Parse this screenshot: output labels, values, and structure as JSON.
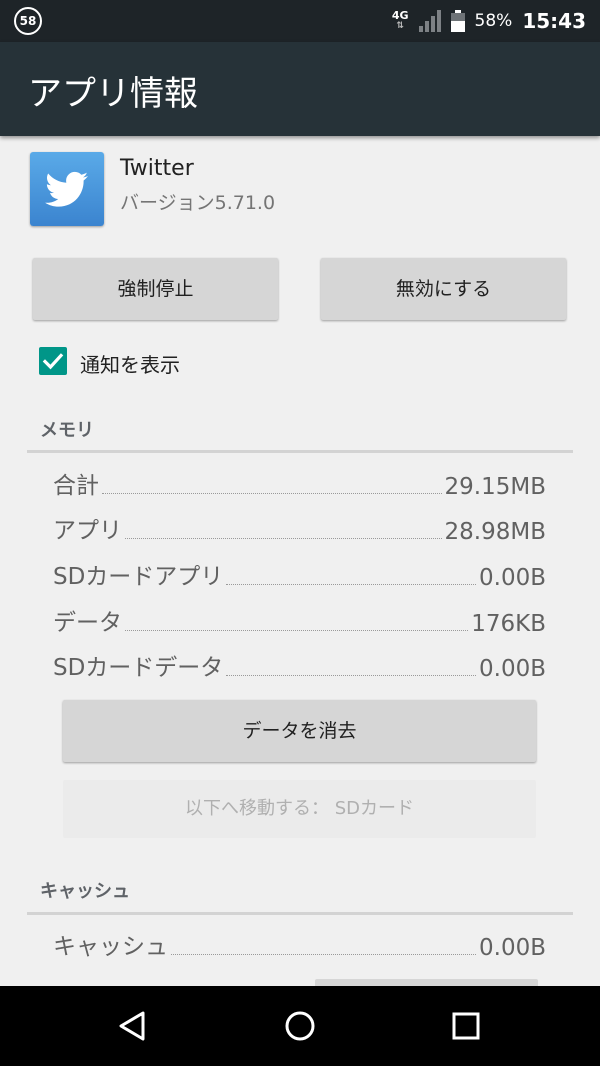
{
  "status_bar": {
    "notification_badge": "58",
    "network": "4G",
    "battery_percent": "58%",
    "battery_level": 0.58,
    "time": "15:43"
  },
  "toolbar": {
    "title": "アプリ情報"
  },
  "app": {
    "name": "Twitter",
    "version": "バージョン5.71.0",
    "icon": "twitter-bird-icon"
  },
  "buttons": {
    "force_stop": "強制停止",
    "disable": "無効にする",
    "clear_data": "データを消去",
    "move_to_sd": "以下へ移動する： SDカード"
  },
  "notifications": {
    "label": "通知を表示",
    "checked": true
  },
  "memory": {
    "header": "メモリ",
    "rows": [
      {
        "label": "合計",
        "value": "29.15MB"
      },
      {
        "label": "アプリ",
        "value": "28.98MB"
      },
      {
        "label": "SDカードアプリ",
        "value": "0.00B"
      },
      {
        "label": "データ",
        "value": "176KB"
      },
      {
        "label": "SDカードデータ",
        "value": "0.00B"
      }
    ]
  },
  "cache": {
    "header": "キャッシュ",
    "rows": [
      {
        "label": "キャッシュ",
        "value": "0.00B"
      }
    ]
  },
  "nav": {
    "back": "back-icon",
    "home": "home-icon",
    "recents": "recents-icon"
  },
  "colors": {
    "toolbar": "#263238",
    "status_bar": "#1e2428",
    "accent": "#009688",
    "button": "#d6d6d6"
  }
}
